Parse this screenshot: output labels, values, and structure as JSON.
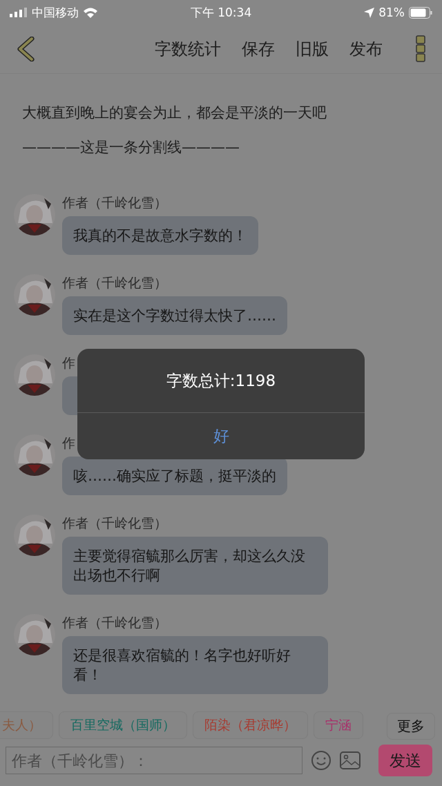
{
  "status_bar": {
    "carrier": "中国移动",
    "time": "下午 10:34",
    "battery": "81%"
  },
  "toolbar": {
    "actions": [
      "字数统计",
      "保存",
      "旧版",
      "发布"
    ]
  },
  "content": {
    "cut_line": "大概直到晚上的宴会为止，都会是平淡的一天吧",
    "divider_text": "————这是一条分割线————"
  },
  "messages": [
    {
      "author": "作者（千岭化雪）",
      "text": "我真的不是故意水字数的！"
    },
    {
      "author": "作者（千岭化雪）",
      "text": "实在是这个字数过得太快了……"
    },
    {
      "author": "作"
    },
    {
      "author": "作",
      "text": "咳……确实应了标题，挺平淡的"
    },
    {
      "author": "作者（千岭化雪）",
      "text": "主要觉得宿毓那么厉害，却这么久没出场也不行啊"
    },
    {
      "author": "作者（千岭化雪）",
      "text": "还是很喜欢宿毓的！名字也好听好看！"
    }
  ],
  "alert": {
    "title": "字数总计:1198",
    "button": "好"
  },
  "role_tags": [
    {
      "label": "夫人）",
      "color": "#8a5a40"
    },
    {
      "label": "百里空城（国师）",
      "color": "#146a60"
    },
    {
      "label": "陌染（君凉晔）",
      "color": "#a83a30"
    },
    {
      "label": "宁涵",
      "color": "#a8306a"
    }
  ],
  "more_button": "更多",
  "composer": {
    "placeholder": "作者（千岭化雪）：",
    "send": "发送"
  }
}
